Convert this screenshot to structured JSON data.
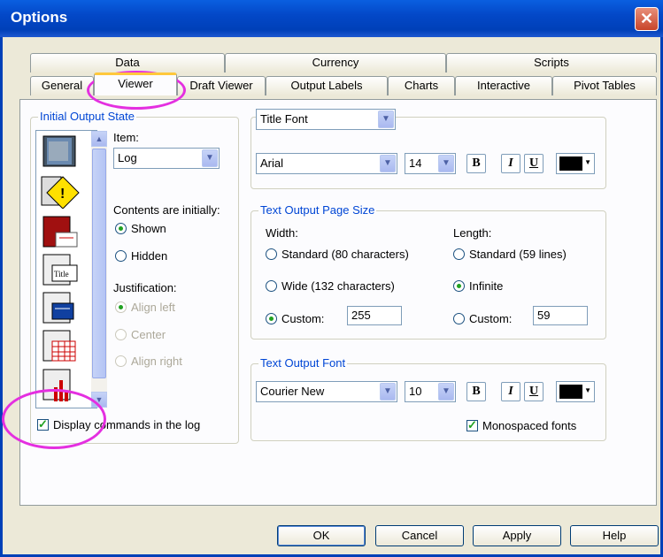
{
  "window": {
    "title": "Options",
    "close": "✕"
  },
  "tabs_row1": [
    "Data",
    "Currency",
    "Scripts"
  ],
  "tabs_row2": [
    "General",
    "Viewer",
    "Draft Viewer",
    "Output Labels",
    "Charts",
    "Interactive",
    "Pivot Tables"
  ],
  "initial_state": {
    "legend": "Initial Output State",
    "item_label": "Item:",
    "item_value": "Log",
    "contents_label": "Contents are initially:",
    "shown": "Shown",
    "hidden": "Hidden",
    "justification_label": "Justification:",
    "align_left": "Align left",
    "center": "Center",
    "align_right": "Align right",
    "display_commands": "Display commands in the log"
  },
  "title_font": {
    "selector": "Title Font",
    "font": "Arial",
    "size": "14"
  },
  "page_size": {
    "legend": "Text Output Page Size",
    "width_label": "Width:",
    "length_label": "Length:",
    "w_standard": "Standard (80 characters)",
    "w_wide": "Wide (132 characters)",
    "w_custom": "Custom:",
    "w_custom_value": "255",
    "l_standard": "Standard (59 lines)",
    "l_infinite": "Infinite",
    "l_custom": "Custom:",
    "l_custom_value": "59"
  },
  "text_font": {
    "legend": "Text Output Font",
    "font": "Courier New",
    "size": "10",
    "monospaced": "Monospaced fonts"
  },
  "format": {
    "bold": "B",
    "italic": "I",
    "underline": "U",
    "color": "#000000"
  },
  "buttons": {
    "ok": "OK",
    "cancel": "Cancel",
    "apply": "Apply",
    "help": "Help"
  },
  "icons": [
    "log-icon",
    "warning-icon",
    "notes-icon",
    "title-icon",
    "text-output-icon",
    "pivot-table-icon",
    "chart-icon"
  ],
  "highlight_color": "#e42fe0"
}
